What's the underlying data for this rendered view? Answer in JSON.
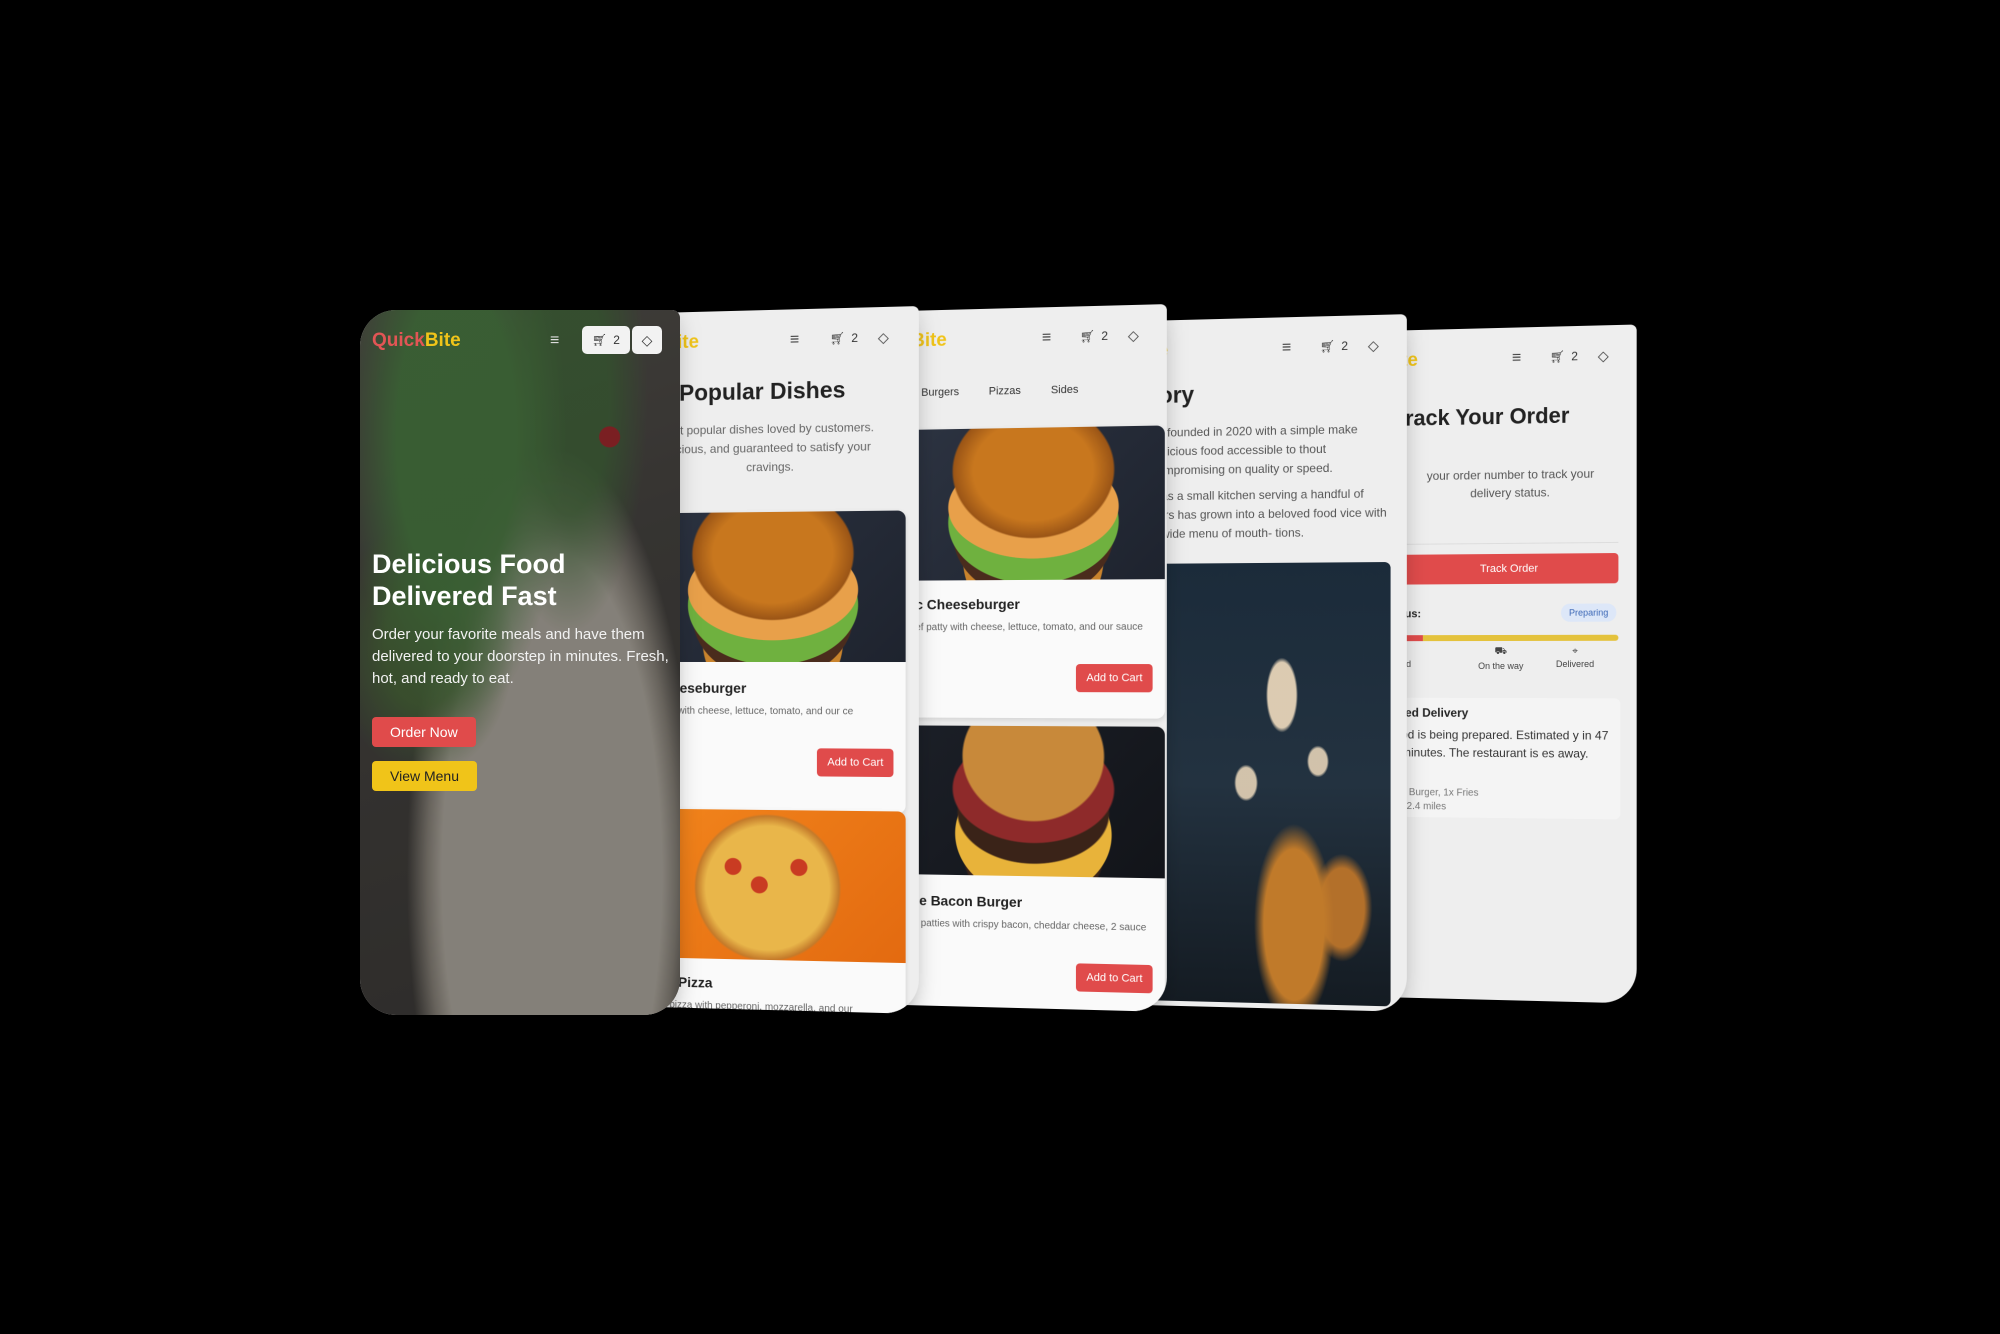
{
  "brand": {
    "part1": "Quick",
    "part2": "Bite",
    "partial_a": "ite",
    "partial_b": "Bite",
    "partial_c": "te"
  },
  "header": {
    "menu_icon": "hamburger-icon",
    "cart_count": "2",
    "cart_icon": "cart-icon",
    "theme_icon": "theme-toggle-icon"
  },
  "hero": {
    "title": "Delicious Food Delivered Fast",
    "subtitle": "Order your favorite meals and have them delivered to your doorstep in minutes. Fresh, hot, and ready to eat.",
    "order_button": "Order Now",
    "menu_button": "View Menu"
  },
  "popular": {
    "title": "Popular Dishes",
    "description": "ost popular dishes loved by customers. licious, and guaranteed to satisfy your cravings.",
    "dishes": [
      {
        "name": "Cheeseburger",
        "description": "patty with cheese, lettuce, tomato, and our ce",
        "button": "Add to Cart"
      },
      {
        "name": "oni Pizza",
        "description": "nal pizza with pepperoni, mozzarella, and our"
      }
    ]
  },
  "menu": {
    "tabs": [
      "Burgers",
      "Pizzas",
      "Sides"
    ],
    "items": [
      {
        "name": "c Cheeseburger",
        "description": "ef patty with cheese, lettuce, tomato, and our sauce",
        "button": "Add to Cart"
      },
      {
        "name": "le Bacon Burger",
        "description": "f patties with crispy bacon, cheddar cheese, 2 sauce",
        "button": "Add to Cart"
      }
    ]
  },
  "story": {
    "title": "tory",
    "paragraph1": "as founded in 2020 with a simple make delicious food accessible to thout compromising on quality or speed.",
    "paragraph2": "d as a small kitchen serving a handful of ners has grown into a beloved food vice with a wide menu of mouth- tions."
  },
  "track": {
    "title": "rack Your Order",
    "description": "your order number to track your delivery status.",
    "button": "Track Order",
    "status_label": "tus:",
    "status_badge": "Preparing",
    "progress": 0.1,
    "steps": [
      {
        "label": "ed",
        "icon": "check-icon"
      },
      {
        "label": "On the way",
        "icon": "truck-icon"
      },
      {
        "label": "Delivered",
        "icon": "map-pin-icon"
      }
    ],
    "estimate_title": "ted Delivery",
    "estimate_text": "od is being prepared. Estimated y in 47 minutes. The restaurant is es away.",
    "items_text": "x Burger, 1x Fries",
    "distance_text": ": 2.4 miles"
  },
  "colors": {
    "accent_red": "#e04b4b",
    "accent_yellow": "#f0c419",
    "badge_blue": "#3a66b5"
  }
}
